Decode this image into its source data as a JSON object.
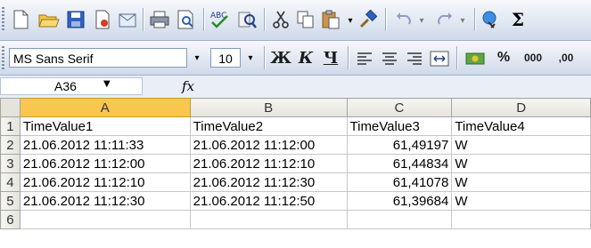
{
  "formula_bar": {
    "name_box": "A36",
    "fx_label": "fx"
  },
  "format_toolbar": {
    "font_name": "MS Sans Serif",
    "font_size": "10",
    "bold": "Ж",
    "italic": "К",
    "underline": "Ч",
    "percent": "%",
    "thousands": "000",
    "dec_increase": ",00"
  },
  "standard_toolbar": {
    "autosum": "Σ"
  },
  "sheet": {
    "columns": [
      "A",
      "B",
      "C",
      "D"
    ],
    "active_column": "A",
    "rows": [
      {
        "num": "1",
        "cells": [
          "TimeValue1",
          "TimeValue2",
          "TimeValue3",
          "TimeValue4"
        ]
      },
      {
        "num": "2",
        "cells": [
          "21.06.2012 11:11:33",
          "21.06.2012 11:12:00",
          "61,49197",
          "W"
        ]
      },
      {
        "num": "3",
        "cells": [
          "21.06.2012 11:12:00",
          "21.06.2012 11:12:10",
          "61,44834",
          "W"
        ]
      },
      {
        "num": "4",
        "cells": [
          "21.06.2012 11:12:10",
          "21.06.2012 11:12:30",
          "61,41078",
          "W"
        ]
      },
      {
        "num": "5",
        "cells": [
          "21.06.2012 11:12:30",
          "21.06.2012 11:12:50",
          "61,39684",
          "W"
        ]
      },
      {
        "num": "6",
        "cells": [
          "",
          "",
          "",
          ""
        ]
      }
    ]
  }
}
